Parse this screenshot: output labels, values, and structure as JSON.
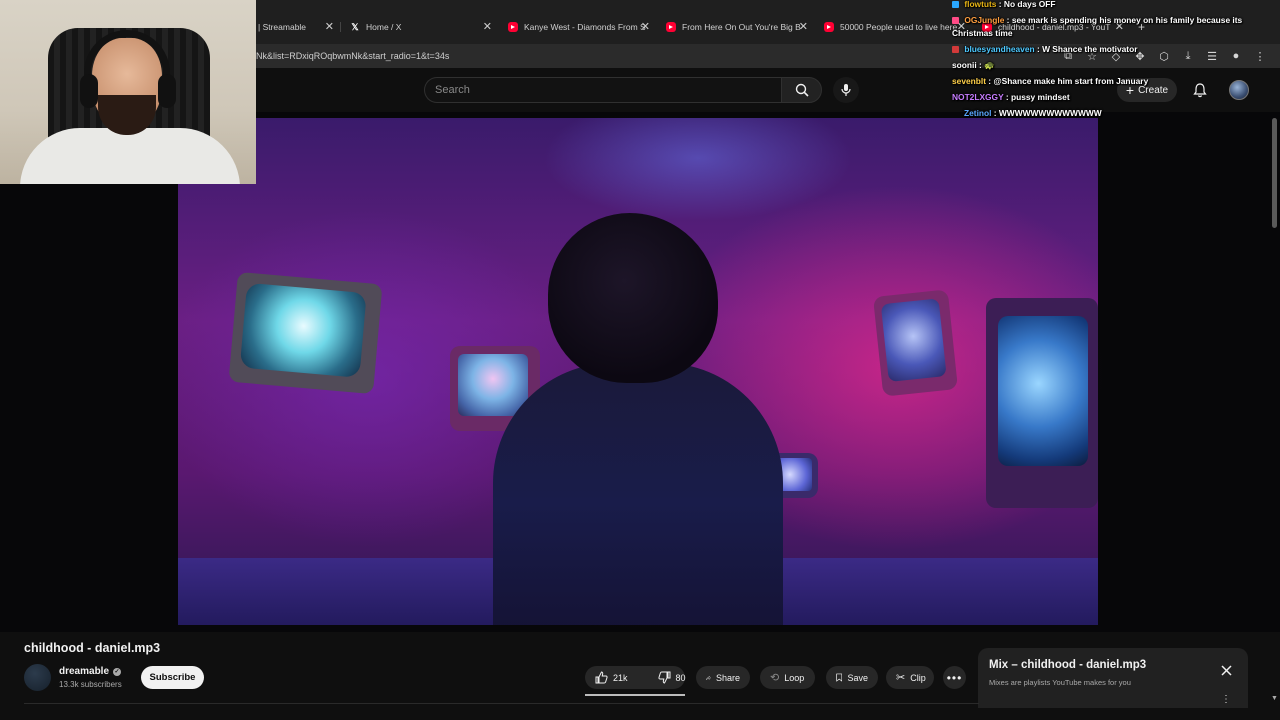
{
  "browser": {
    "tabs": [
      {
        "label": "| Streamable",
        "favicon": "streamable-icon"
      },
      {
        "label": "Home / X",
        "favicon": "x-logo-icon"
      },
      {
        "label": "Kanye West - Diamonds From S",
        "favicon": "youtube-icon"
      },
      {
        "label": "From Here On Out You're Big B",
        "favicon": "youtube-icon"
      },
      {
        "label": "50000 People used to live here",
        "favicon": "youtube-icon"
      },
      {
        "label": "childhood - daniel.mp3 - YouT",
        "favicon": "youtube-icon"
      }
    ],
    "new_tab_symbol": "+",
    "url": "Nk&list=RDxiqROqbwmNk&start_radio=1&t=34s"
  },
  "youtube": {
    "search_placeholder": "Search",
    "create_label": "Create"
  },
  "chat": [
    {
      "user": "flowtuts",
      "text": "No days OFF",
      "color": "#e7b416",
      "badge": "#2aa7ff"
    },
    {
      "user": "OGJungle",
      "text": "see mark is spending his money on his family because its",
      "cont": "Christmas time",
      "color": "#ff9f40",
      "badge": "#ff4b86"
    },
    {
      "user": "bluesyandheaven",
      "text": "W Shance the motivator",
      "color": "#4ec9ff",
      "badge": "#d23a3a"
    },
    {
      "user": "soonii",
      "text": "🐢",
      "color": "#ffffff",
      "badge": ""
    },
    {
      "user": "sevenblt",
      "text": "@Shance make him start from January",
      "color": "#ffd04a",
      "badge": ""
    },
    {
      "user": "NOT2LXGGY",
      "text": "pussy mindset",
      "color": "#c77dff",
      "badge": ""
    },
    {
      "user": "Zetinol",
      "text": "WWWWWWWWWWWWW",
      "color": "#5aa7ff",
      "badge": ""
    }
  ],
  "video": {
    "title": "childhood - daniel.mp3",
    "channel": "dreamable",
    "subscribers": "13.3k subscribers",
    "subscribe_label": "Subscribe",
    "likes": "21k",
    "dislikes": "80",
    "like_ratio": 0.996,
    "share_label": "Share",
    "loop_label": "Loop",
    "save_label": "Save",
    "clip_label": "Clip"
  },
  "mix": {
    "title": "Mix – childhood - daniel.mp3",
    "subtitle": "Mixes are playlists YouTube makes for you"
  }
}
